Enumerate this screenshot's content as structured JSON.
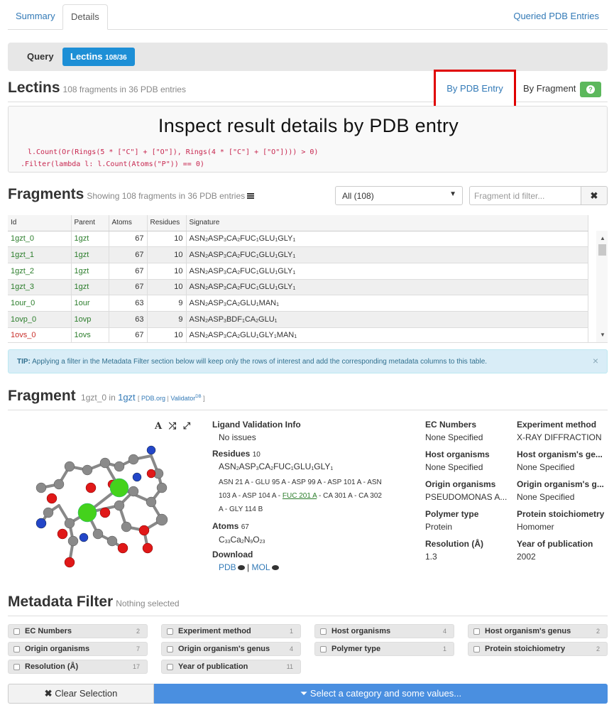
{
  "tabs": {
    "summary": "Summary",
    "details": "Details",
    "queried": "Queried PDB Entries"
  },
  "query_bar": {
    "query_label": "Query",
    "lectins_label": "Lectins",
    "lectins_count": "108/36"
  },
  "lectins": {
    "title": "Lectins",
    "subtitle": "108 fragments in 36 PDB entries",
    "by_pdb_entry": "By PDB Entry",
    "by_fragment": "By Fragment",
    "help": "?"
  },
  "overlay_title": "Inspect result details by PDB entry",
  "code_lines": [
    "l.Count(Or(Rings(5 * [\"C\"] + [\"O\"]), Rings(4 * [\"C\"] + [\"O\"]))) > 0)",
    ".Filter(lambda l: l.Count(Atoms(\"P\")) == 0)"
  ],
  "fragments": {
    "title": "Fragments",
    "subtitle": "Showing 108 fragments in 36 PDB entries",
    "select_value": "All (108)",
    "filter_placeholder": "Fragment id filter...",
    "columns": [
      "Id",
      "Parent",
      "Atoms",
      "Residues",
      "Signature"
    ],
    "rows": [
      {
        "id": "1gzt_0",
        "parent": "1gzt",
        "atoms": "67",
        "residues": "10",
        "sig": [
          [
            "ASN",
            "2"
          ],
          [
            "ASP",
            "3"
          ],
          [
            "CA",
            "2"
          ],
          [
            "FUC",
            "1"
          ],
          [
            "GLU",
            "1"
          ],
          [
            "GLY",
            "1"
          ]
        ],
        "status": "green"
      },
      {
        "id": "1gzt_1",
        "parent": "1gzt",
        "atoms": "67",
        "residues": "10",
        "sig": [
          [
            "ASN",
            "2"
          ],
          [
            "ASP",
            "3"
          ],
          [
            "CA",
            "2"
          ],
          [
            "FUC",
            "1"
          ],
          [
            "GLU",
            "1"
          ],
          [
            "GLY",
            "1"
          ]
        ],
        "status": "green"
      },
      {
        "id": "1gzt_2",
        "parent": "1gzt",
        "atoms": "67",
        "residues": "10",
        "sig": [
          [
            "ASN",
            "2"
          ],
          [
            "ASP",
            "3"
          ],
          [
            "CA",
            "2"
          ],
          [
            "FUC",
            "1"
          ],
          [
            "GLU",
            "1"
          ],
          [
            "GLY",
            "1"
          ]
        ],
        "status": "green"
      },
      {
        "id": "1gzt_3",
        "parent": "1gzt",
        "atoms": "67",
        "residues": "10",
        "sig": [
          [
            "ASN",
            "2"
          ],
          [
            "ASP",
            "3"
          ],
          [
            "CA",
            "2"
          ],
          [
            "FUC",
            "1"
          ],
          [
            "GLU",
            "1"
          ],
          [
            "GLY",
            "1"
          ]
        ],
        "status": "green"
      },
      {
        "id": "1our_0",
        "parent": "1our",
        "atoms": "63",
        "residues": "9",
        "sig": [
          [
            "ASN",
            "2"
          ],
          [
            "ASP",
            "3"
          ],
          [
            "CA",
            "2"
          ],
          [
            "GLU",
            "1"
          ],
          [
            "MAN",
            "1"
          ]
        ],
        "status": "green"
      },
      {
        "id": "1ovp_0",
        "parent": "1ovp",
        "atoms": "63",
        "residues": "9",
        "sig": [
          [
            "ASN",
            "2"
          ],
          [
            "ASP",
            "3"
          ],
          [
            "BDF",
            "1"
          ],
          [
            "CA",
            "2"
          ],
          [
            "GLU",
            "1"
          ]
        ],
        "status": "green"
      },
      {
        "id": "1ovs_0",
        "parent": "1ovs",
        "atoms": "67",
        "residues": "10",
        "sig": [
          [
            "ASN",
            "2"
          ],
          [
            "ASP",
            "3"
          ],
          [
            "CA",
            "2"
          ],
          [
            "GLU",
            "1"
          ],
          [
            "GLY",
            "1"
          ],
          [
            "MAN",
            "1"
          ]
        ],
        "status": "red"
      }
    ]
  },
  "tip": {
    "prefix": "TIP:",
    "text": "Applying a filter in the Metadata Filter section below will keep only the rows of interest and add the corresponding metadata columns to this table.",
    "close": "×"
  },
  "fragment": {
    "title": "Fragment",
    "id": "1gzt_0",
    "in": "in",
    "parent": "1gzt",
    "pdb_org": "PDB.org",
    "validator": "Validator",
    "validator_sup": "DB",
    "ligand_validation_label": "Ligand Validation Info",
    "ligand_validation_value": "No issues",
    "residues_label": "Residues",
    "residues_count": "10",
    "residues_sig": [
      [
        "ASN",
        "2"
      ],
      [
        "ASP",
        "3"
      ],
      [
        "CA",
        "2"
      ],
      [
        "FUC",
        "1"
      ],
      [
        "GLU",
        "1"
      ],
      [
        "GLY",
        "1"
      ]
    ],
    "residues_line1": "ASN 21 A - GLU 95 A - ASP 99 A - ASP 101 A - ASN",
    "residues_line2_a": "103 A - ASP 104 A - ",
    "residues_line2_link": "FUC 201 A",
    "residues_line2_b": " - CA 301 A - CA 302",
    "residues_line3": "A - GLY 114 B",
    "atoms_label": "Atoms",
    "atoms_count": "67",
    "formula": [
      [
        "C",
        "33"
      ],
      [
        "Ca",
        "2"
      ],
      [
        "N",
        "9"
      ],
      [
        "O",
        "23"
      ]
    ],
    "download_label": "Download",
    "download_pdb": "PDB",
    "download_sep": "|",
    "download_mol": "MOL"
  },
  "metadata_cols": [
    {
      "label": "EC Numbers",
      "value": "None Specified"
    },
    {
      "label": "Experiment method",
      "value": "X-RAY DIFFRACTION"
    },
    {
      "label": "Host organisms",
      "value": "None Specified"
    },
    {
      "label": "Host organism's ge...",
      "value": "None Specified"
    },
    {
      "label": "Origin organisms",
      "value": "PSEUDOMONAS A..."
    },
    {
      "label": "Origin organism's g...",
      "value": "None Specified"
    },
    {
      "label": "Polymer type",
      "value": "Protein"
    },
    {
      "label": "Protein stoichiometry",
      "value": "Homomer"
    },
    {
      "label": "Resolution (Å)",
      "value": "1.3"
    },
    {
      "label": "Year of publication",
      "value": "2002"
    }
  ],
  "metadata_filter": {
    "title": "Metadata Filter",
    "subtitle": "Nothing selected",
    "chips": [
      {
        "label": "EC Numbers",
        "count": "2"
      },
      {
        "label": "Experiment method",
        "count": "1"
      },
      {
        "label": "Host organisms",
        "count": "4"
      },
      {
        "label": "Host organism's genus",
        "count": "2"
      },
      {
        "label": "Origin organisms",
        "count": "7"
      },
      {
        "label": "Origin organism's genus",
        "count": "4"
      },
      {
        "label": "Polymer type",
        "count": "1"
      },
      {
        "label": "Protein stoichiometry",
        "count": "2"
      },
      {
        "label": "Resolution (Å)",
        "count": "17"
      },
      {
        "label": "Year of publication",
        "count": "11"
      }
    ]
  },
  "bottom": {
    "clear_selection": "Clear Selection",
    "select_category": "Select a category and some values..."
  },
  "colors": {
    "accent": "#1d8fd6",
    "link": "#337ab7",
    "ok_green": "#2b7d2b",
    "error_red": "#c9302c",
    "highlight_box": "#e00000",
    "primary_button": "#4a8fe0"
  }
}
